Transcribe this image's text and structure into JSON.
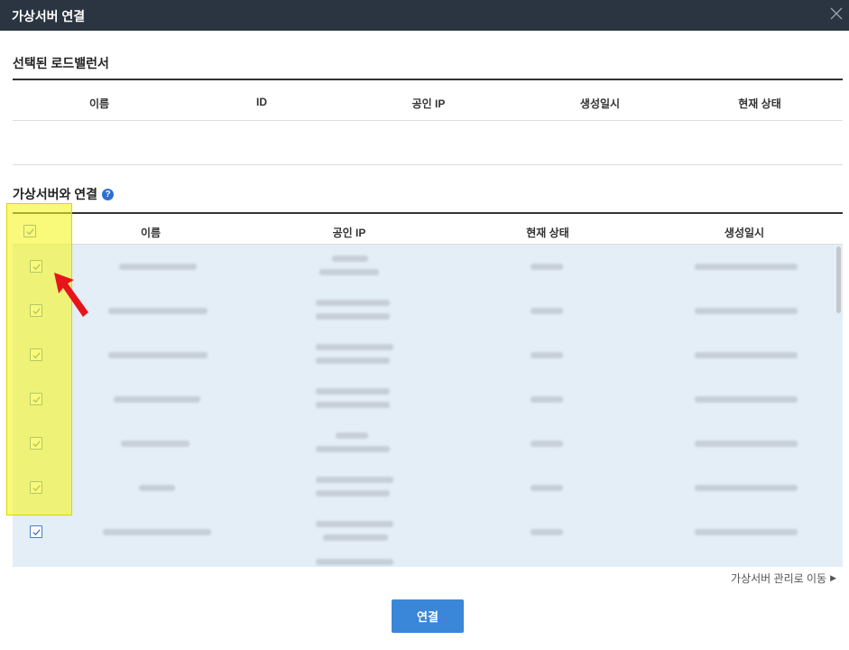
{
  "dialog": {
    "title": "가상서버 연결",
    "close_icon": "close-icon"
  },
  "selected_lb": {
    "title": "선택된 로드밸런서",
    "columns": [
      "이름",
      "ID",
      "공인 IP",
      "생성일시",
      "현재 상태"
    ],
    "rows": []
  },
  "virtual_servers": {
    "title": "가상서버와 연결",
    "help_icon": "help-circle-icon",
    "columns": [
      "이름",
      "공인 IP",
      "현재 상태",
      "생성일시"
    ],
    "header_checked": true,
    "rows_checked": [
      true,
      true,
      true,
      true,
      true,
      true,
      true,
      true
    ]
  },
  "footer": {
    "manage_link": "가상서버 관리로 이동",
    "connect_label": "연결"
  },
  "colors": {
    "titlebar": "#2b3441",
    "accent": "#3a86d9",
    "row_selected": "#e3eef7",
    "highlight": "#f6f628",
    "annotation_arrow": "#e8141b"
  }
}
